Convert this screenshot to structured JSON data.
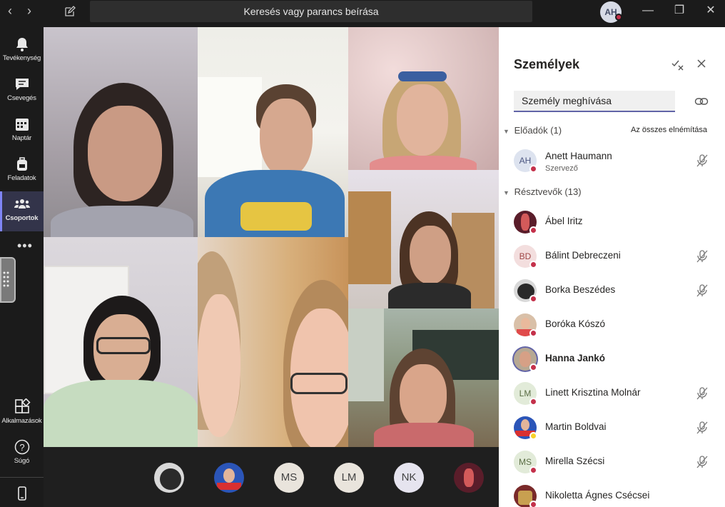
{
  "titlebar": {
    "search_text": "Keresés vagy parancs beírása",
    "me_initials": "AH",
    "back_glyph": "‹",
    "forward_glyph": "›",
    "minimize_glyph": "—",
    "maximize_glyph": "❐",
    "close_glyph": "✕"
  },
  "rail": {
    "items": [
      {
        "label": "Tevékenység",
        "icon": "bell-icon"
      },
      {
        "label": "Csevegés",
        "icon": "chat-icon"
      },
      {
        "label": "Naptár",
        "icon": "calendar-icon"
      },
      {
        "label": "Feladatok",
        "icon": "backpack-icon"
      },
      {
        "label": "Csoportok",
        "icon": "teams-icon"
      },
      {
        "label": "Alkalmazások",
        "icon": "apps-icon"
      },
      {
        "label": "Súgó",
        "icon": "help-icon"
      },
      {
        "label": "",
        "icon": "device-icon"
      }
    ],
    "more_glyph": "•••"
  },
  "bottom_avatars": [
    {
      "initials": ""
    },
    {
      "initials": ""
    },
    {
      "initials": "MS"
    },
    {
      "initials": "LM"
    },
    {
      "initials": "NK"
    },
    {
      "initials": ""
    }
  ],
  "panel": {
    "title": "Személyek",
    "invite_placeholder": "Személy meghívása",
    "presenters_label": "Előadók (1)",
    "mute_all_label": "Az összes elnémítása",
    "attendees_label": "Résztvevők (13)",
    "presenters": [
      {
        "name": "Anett Haumann",
        "sub": "Szervező",
        "initials": "AH",
        "muted": true
      }
    ],
    "attendees": [
      {
        "name": "Ábel Iritz",
        "initials": "",
        "muted": false,
        "bold": false
      },
      {
        "name": "Bálint Debreczeni",
        "initials": "BD",
        "muted": true,
        "bold": false
      },
      {
        "name": "Borka Beszédes",
        "initials": "",
        "muted": true,
        "bold": false
      },
      {
        "name": "Boróka Kószó",
        "initials": "",
        "muted": false,
        "bold": false
      },
      {
        "name": "Hanna Jankó",
        "initials": "",
        "muted": false,
        "bold": true
      },
      {
        "name": "Linett Krisztina Molnár",
        "initials": "LM",
        "muted": true,
        "bold": false
      },
      {
        "name": "Martin Boldvai",
        "initials": "",
        "muted": true,
        "bold": false,
        "away": true
      },
      {
        "name": "Mirella Szécsi",
        "initials": "MS",
        "muted": true,
        "bold": false
      },
      {
        "name": "Nikoletta Ágnes Csécsei",
        "initials": "",
        "muted": false,
        "bold": false
      }
    ]
  }
}
